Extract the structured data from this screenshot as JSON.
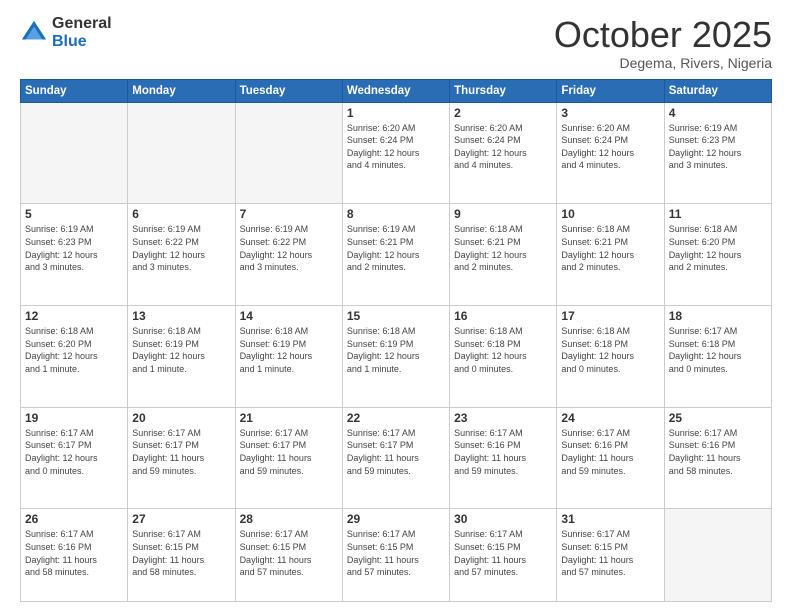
{
  "logo": {
    "general": "General",
    "blue": "Blue"
  },
  "title": "October 2025",
  "subtitle": "Degema, Rivers, Nigeria",
  "days_header": [
    "Sunday",
    "Monday",
    "Tuesday",
    "Wednesday",
    "Thursday",
    "Friday",
    "Saturday"
  ],
  "weeks": [
    [
      {
        "num": "",
        "info": ""
      },
      {
        "num": "",
        "info": ""
      },
      {
        "num": "",
        "info": ""
      },
      {
        "num": "1",
        "info": "Sunrise: 6:20 AM\nSunset: 6:24 PM\nDaylight: 12 hours\nand 4 minutes."
      },
      {
        "num": "2",
        "info": "Sunrise: 6:20 AM\nSunset: 6:24 PM\nDaylight: 12 hours\nand 4 minutes."
      },
      {
        "num": "3",
        "info": "Sunrise: 6:20 AM\nSunset: 6:24 PM\nDaylight: 12 hours\nand 4 minutes."
      },
      {
        "num": "4",
        "info": "Sunrise: 6:19 AM\nSunset: 6:23 PM\nDaylight: 12 hours\nand 3 minutes."
      }
    ],
    [
      {
        "num": "5",
        "info": "Sunrise: 6:19 AM\nSunset: 6:23 PM\nDaylight: 12 hours\nand 3 minutes."
      },
      {
        "num": "6",
        "info": "Sunrise: 6:19 AM\nSunset: 6:22 PM\nDaylight: 12 hours\nand 3 minutes."
      },
      {
        "num": "7",
        "info": "Sunrise: 6:19 AM\nSunset: 6:22 PM\nDaylight: 12 hours\nand 3 minutes."
      },
      {
        "num": "8",
        "info": "Sunrise: 6:19 AM\nSunset: 6:21 PM\nDaylight: 12 hours\nand 2 minutes."
      },
      {
        "num": "9",
        "info": "Sunrise: 6:18 AM\nSunset: 6:21 PM\nDaylight: 12 hours\nand 2 minutes."
      },
      {
        "num": "10",
        "info": "Sunrise: 6:18 AM\nSunset: 6:21 PM\nDaylight: 12 hours\nand 2 minutes."
      },
      {
        "num": "11",
        "info": "Sunrise: 6:18 AM\nSunset: 6:20 PM\nDaylight: 12 hours\nand 2 minutes."
      }
    ],
    [
      {
        "num": "12",
        "info": "Sunrise: 6:18 AM\nSunset: 6:20 PM\nDaylight: 12 hours\nand 1 minute."
      },
      {
        "num": "13",
        "info": "Sunrise: 6:18 AM\nSunset: 6:19 PM\nDaylight: 12 hours\nand 1 minute."
      },
      {
        "num": "14",
        "info": "Sunrise: 6:18 AM\nSunset: 6:19 PM\nDaylight: 12 hours\nand 1 minute."
      },
      {
        "num": "15",
        "info": "Sunrise: 6:18 AM\nSunset: 6:19 PM\nDaylight: 12 hours\nand 1 minute."
      },
      {
        "num": "16",
        "info": "Sunrise: 6:18 AM\nSunset: 6:18 PM\nDaylight: 12 hours\nand 0 minutes."
      },
      {
        "num": "17",
        "info": "Sunrise: 6:18 AM\nSunset: 6:18 PM\nDaylight: 12 hours\nand 0 minutes."
      },
      {
        "num": "18",
        "info": "Sunrise: 6:17 AM\nSunset: 6:18 PM\nDaylight: 12 hours\nand 0 minutes."
      }
    ],
    [
      {
        "num": "19",
        "info": "Sunrise: 6:17 AM\nSunset: 6:17 PM\nDaylight: 12 hours\nand 0 minutes."
      },
      {
        "num": "20",
        "info": "Sunrise: 6:17 AM\nSunset: 6:17 PM\nDaylight: 11 hours\nand 59 minutes."
      },
      {
        "num": "21",
        "info": "Sunrise: 6:17 AM\nSunset: 6:17 PM\nDaylight: 11 hours\nand 59 minutes."
      },
      {
        "num": "22",
        "info": "Sunrise: 6:17 AM\nSunset: 6:17 PM\nDaylight: 11 hours\nand 59 minutes."
      },
      {
        "num": "23",
        "info": "Sunrise: 6:17 AM\nSunset: 6:16 PM\nDaylight: 11 hours\nand 59 minutes."
      },
      {
        "num": "24",
        "info": "Sunrise: 6:17 AM\nSunset: 6:16 PM\nDaylight: 11 hours\nand 59 minutes."
      },
      {
        "num": "25",
        "info": "Sunrise: 6:17 AM\nSunset: 6:16 PM\nDaylight: 11 hours\nand 58 minutes."
      }
    ],
    [
      {
        "num": "26",
        "info": "Sunrise: 6:17 AM\nSunset: 6:16 PM\nDaylight: 11 hours\nand 58 minutes."
      },
      {
        "num": "27",
        "info": "Sunrise: 6:17 AM\nSunset: 6:15 PM\nDaylight: 11 hours\nand 58 minutes."
      },
      {
        "num": "28",
        "info": "Sunrise: 6:17 AM\nSunset: 6:15 PM\nDaylight: 11 hours\nand 57 minutes."
      },
      {
        "num": "29",
        "info": "Sunrise: 6:17 AM\nSunset: 6:15 PM\nDaylight: 11 hours\nand 57 minutes."
      },
      {
        "num": "30",
        "info": "Sunrise: 6:17 AM\nSunset: 6:15 PM\nDaylight: 11 hours\nand 57 minutes."
      },
      {
        "num": "31",
        "info": "Sunrise: 6:17 AM\nSunset: 6:15 PM\nDaylight: 11 hours\nand 57 minutes."
      },
      {
        "num": "",
        "info": ""
      }
    ]
  ]
}
